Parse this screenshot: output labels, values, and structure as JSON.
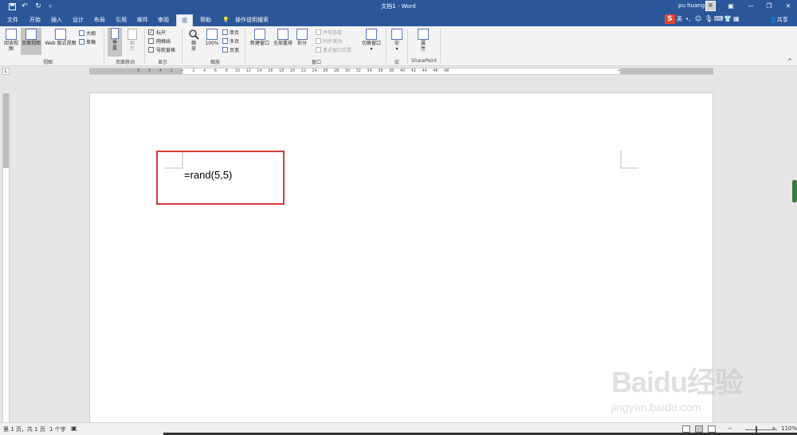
{
  "window": {
    "title": "文档1 - Word",
    "user_name": "pu huang",
    "share_label": "共享"
  },
  "tabs": [
    {
      "label": "文件"
    },
    {
      "label": "开始"
    },
    {
      "label": "插入"
    },
    {
      "label": "设计"
    },
    {
      "label": "布局"
    },
    {
      "label": "引用"
    },
    {
      "label": "邮件"
    },
    {
      "label": "审阅"
    },
    {
      "label": "视图"
    },
    {
      "label": "帮助"
    },
    {
      "label": "操作说明搜索"
    }
  ],
  "active_tab": "视图",
  "ime": {
    "label": "英"
  },
  "ribbon": {
    "views": {
      "read_mode": "阅读视图",
      "print_layout": "页面视图",
      "web_layout": "Web 版式视图",
      "outline": "大纲",
      "draft": "草稿",
      "group_label": "视图"
    },
    "page_movement": {
      "vertical": "垂直",
      "side_to_side": "翻页",
      "group_label": "页面移动"
    },
    "show": {
      "ruler": {
        "label": "标尺",
        "checked": true
      },
      "gridlines": {
        "label": "网格线",
        "checked": false
      },
      "navigation_pane": {
        "label": "导航窗格",
        "checked": false
      },
      "group_label": "显示"
    },
    "zoom": {
      "zoom": "缩放",
      "hundred": "100%",
      "one_page": "单页",
      "multiple_pages": "多页",
      "page_width": "页宽",
      "group_label": "缩放"
    },
    "window": {
      "new_window": "新建窗口",
      "arrange_all": "全部重排",
      "split": "拆分",
      "view_side_by_side": "并排查看",
      "synchronous_scrolling": "同步滚动",
      "reset_window_position": "重设窗口位置",
      "switch_windows": "切换窗口",
      "group_label": "窗口"
    },
    "macros": {
      "label": "宏",
      "group_label": "宏"
    },
    "sharepoint": {
      "properties": "属性",
      "group_label": "SharePoint"
    }
  },
  "ruler_numbers": [
    "8",
    "6",
    "4",
    "2",
    "2",
    "4",
    "6",
    "8",
    "10",
    "12",
    "14",
    "16",
    "18",
    "20",
    "22",
    "24",
    "26",
    "28",
    "30",
    "32",
    "34",
    "36",
    "38",
    "40",
    "42",
    "44",
    "46",
    "48"
  ],
  "document": {
    "text": "=rand(5,5)"
  },
  "status": {
    "page": "第 1 页，共 1 页",
    "words": "1 个字",
    "zoom": "110%"
  },
  "watermark": {
    "brand": "Baidu经验",
    "url": "jingyan.baidu.com"
  },
  "colors": {
    "accent": "#2b579a",
    "annotation": "#d63a3a"
  }
}
